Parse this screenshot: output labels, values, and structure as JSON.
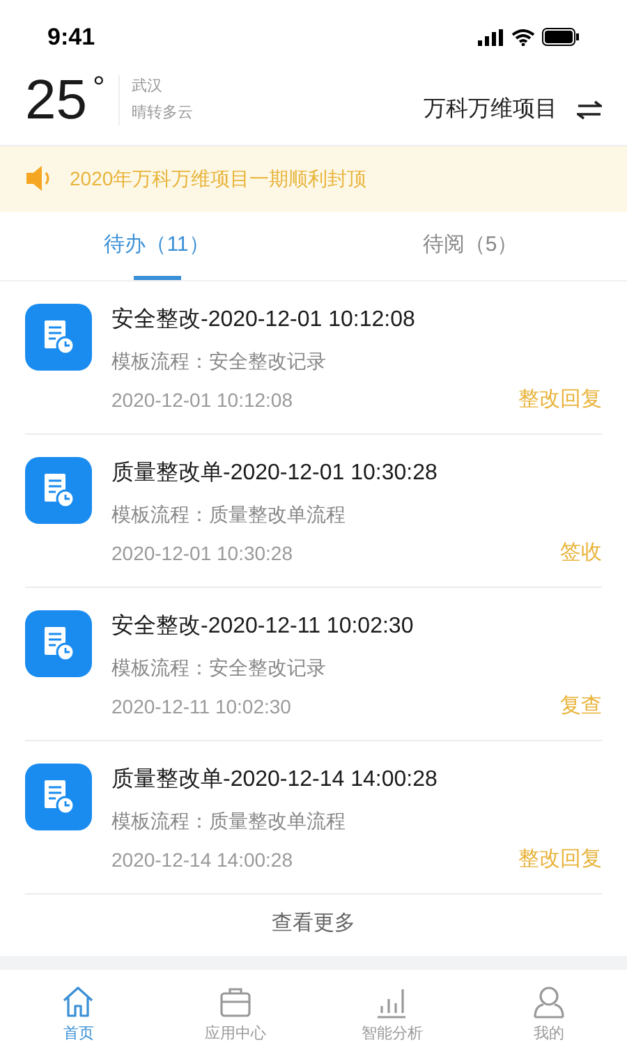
{
  "status_bar": {
    "time": "9:41"
  },
  "weather": {
    "temperature": "25",
    "degree": "°",
    "city": "武汉",
    "condition": "晴转多云"
  },
  "project": {
    "name": "万科万维项目"
  },
  "notice": {
    "text": "2020年万科万维项目一期顺利封顶"
  },
  "tabs": [
    {
      "label": "待办",
      "count": "（11）",
      "selected": true
    },
    {
      "label": "待阅",
      "count": "（5）",
      "selected": false
    }
  ],
  "tasks": [
    {
      "title": "安全整改-2020-12-01 10:12:08",
      "flow": "模板流程：安全整改记录",
      "time": "2020-12-01 10:12:08",
      "action": "整改回复"
    },
    {
      "title": "质量整改单-2020-12-01 10:30:28",
      "flow": "模板流程：质量整改单流程",
      "time": "2020-12-01 10:30:28",
      "action": "签收"
    },
    {
      "title": "安全整改-2020-12-11 10:02:30",
      "flow": "模板流程：安全整改记录",
      "time": "2020-12-11 10:02:30",
      "action": "复查"
    },
    {
      "title": "质量整改单-2020-12-14 14:00:28",
      "flow": "模板流程：质量整改单流程",
      "time": "2020-12-14 14:00:28",
      "action": "整改回复"
    }
  ],
  "more": {
    "label": "查看更多"
  },
  "nav": [
    {
      "label": "首页",
      "kind": "home",
      "selected": true
    },
    {
      "label": "应用中心",
      "kind": "apps",
      "selected": false
    },
    {
      "label": "智能分析",
      "kind": "analysis",
      "selected": false
    },
    {
      "label": "我的",
      "kind": "profile",
      "selected": false
    }
  ]
}
